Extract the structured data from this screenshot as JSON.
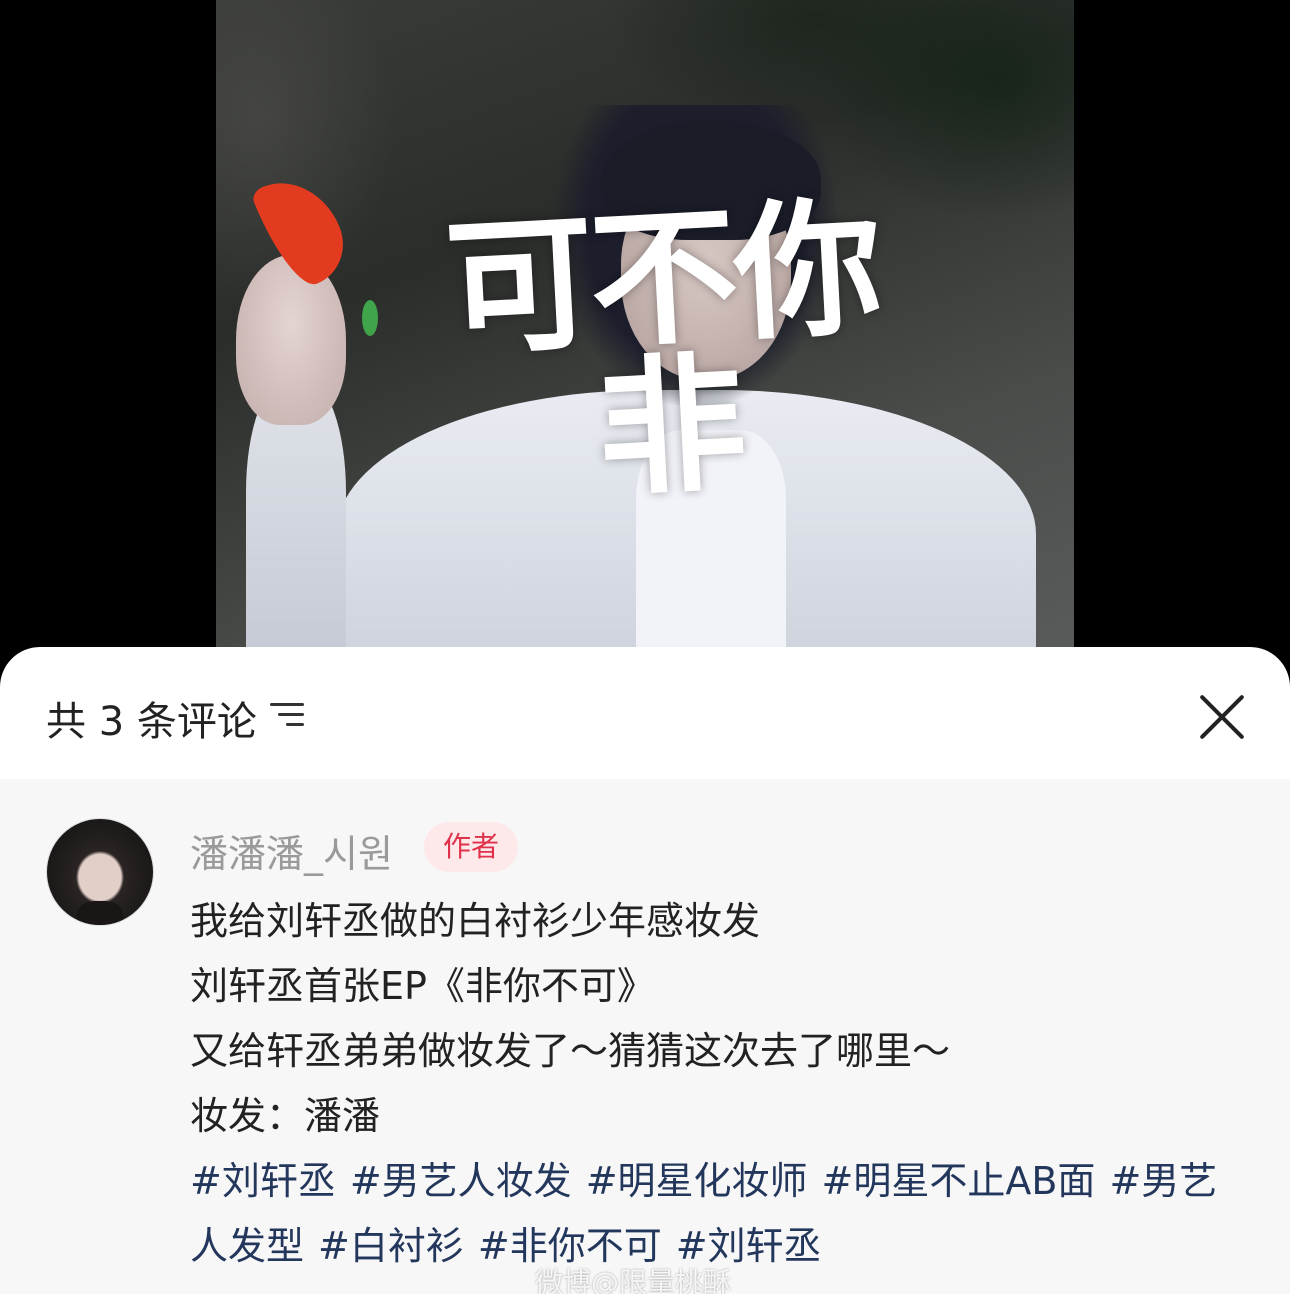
{
  "video": {
    "overlay_title": "可不你非"
  },
  "header": {
    "comment_count_label": "共 3 条评论",
    "sort_icon": "sort-lines-icon",
    "close_icon": "close-icon"
  },
  "comment": {
    "username": "潘潘潘_시원",
    "badge": "作者",
    "lines": [
      "我给刘轩丞做的白衬衫少年感妆发",
      "刘轩丞首张EP《非你不可》",
      "又给轩丞弟弟做妆发了～猜猜这次去了哪里～",
      "妆发：潘潘"
    ],
    "hashtags": [
      "#刘轩丞",
      "#男艺人妆发",
      "#明星化妆师",
      "#明星不止AB面",
      "#男艺人发型",
      "#白衬衫",
      "#非你不可",
      "#刘轩丞"
    ]
  },
  "watermark": "微博@限量桃酥",
  "colors": {
    "badge_text": "#e0314b",
    "badge_bg": "#fde8ea",
    "hashtag": "#23375c",
    "username": "#9a9a9a"
  }
}
